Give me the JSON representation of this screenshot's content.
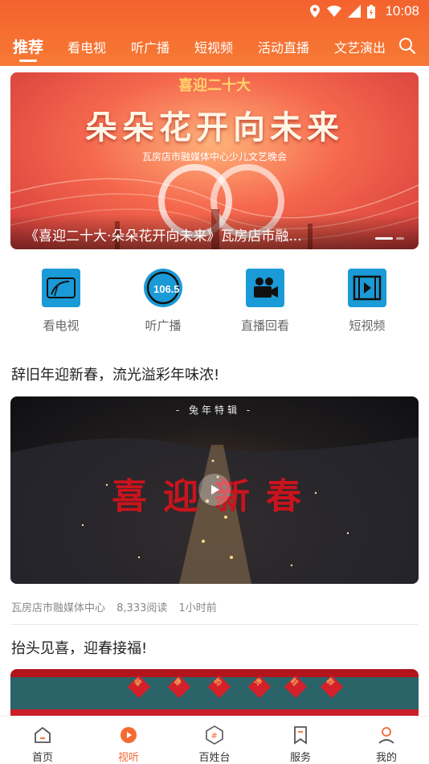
{
  "status_bar": {
    "time": "10:08"
  },
  "top_tabs": [
    {
      "label": "推荐",
      "active": true
    },
    {
      "label": "看电视"
    },
    {
      "label": "听广播"
    },
    {
      "label": "短视频"
    },
    {
      "label": "活动直播"
    },
    {
      "label": "文艺演出"
    }
  ],
  "banner": {
    "line1": "喜迎二十大",
    "line2": "朵朵花开向未来",
    "line3": "瓦房店市融媒体中心少儿文艺晚会",
    "caption": "《喜迎二十大·朵朵花开向未来》瓦房店市融..."
  },
  "quick_links": [
    {
      "label": "看电视",
      "icon": "tv-icon"
    },
    {
      "label": "听广播",
      "icon": "radio-icon"
    },
    {
      "label": "直播回看",
      "icon": "camera-icon"
    },
    {
      "label": "短视频",
      "icon": "video-icon"
    }
  ],
  "articles": [
    {
      "title": "辞旧年迎新春，流光溢彩年味浓!",
      "video_badge": "- 兔年特辑 -",
      "video_text": "喜迎新春",
      "source": "瓦房店市融媒体中心",
      "reads": "8,333阅读",
      "time": "1小时前"
    },
    {
      "title": "抬头见喜，迎春接福!",
      "fu_marks": [
        "福",
        "鲁",
        "韵",
        "贵",
        "鞋",
        "群"
      ]
    }
  ],
  "bottom_nav": [
    {
      "label": "首页",
      "icon": "home-icon"
    },
    {
      "label": "视听",
      "icon": "play-icon",
      "active": true
    },
    {
      "label": "百姓台",
      "icon": "hashtag-icon"
    },
    {
      "label": "服务",
      "icon": "bookmark-icon"
    },
    {
      "label": "我的",
      "icon": "user-icon"
    }
  ],
  "colors": {
    "accent": "#f46a30",
    "header_top": "#f4622e",
    "icon_blue": "#1a9ad6"
  }
}
